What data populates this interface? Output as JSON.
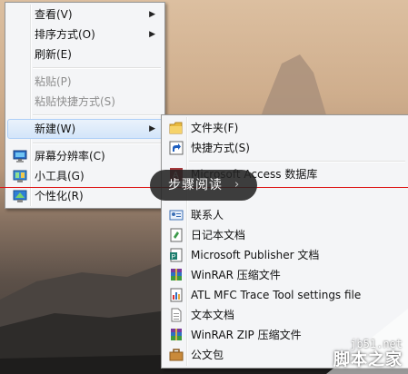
{
  "context_menu": {
    "items": [
      {
        "label": "查看(V)",
        "has_submenu": true
      },
      {
        "label": "排序方式(O)",
        "has_submenu": true
      },
      {
        "label": "刷新(E)"
      },
      {
        "label": "粘贴(P)",
        "disabled": true
      },
      {
        "label": "粘贴快捷方式(S)",
        "disabled": true
      },
      {
        "label": "新建(W)",
        "has_submenu": true,
        "highlighted": true
      },
      {
        "label": "屏幕分辨率(C)",
        "icon": "screen-resolution-icon"
      },
      {
        "label": "小工具(G)",
        "icon": "gadgets-icon"
      },
      {
        "label": "个性化(R)",
        "icon": "personalize-icon"
      }
    ]
  },
  "new_submenu": {
    "items": [
      {
        "label": "文件夹(F)",
        "icon": "folder-icon"
      },
      {
        "label": "快捷方式(S)",
        "icon": "shortcut-icon"
      },
      {
        "label": "Microsoft Access 数据库",
        "icon": "access-db-icon"
      },
      {
        "label": "联系人",
        "icon": "contact-icon"
      },
      {
        "label": "日记本文档",
        "icon": "journal-icon"
      },
      {
        "label": "Microsoft Publisher 文档",
        "icon": "publisher-icon"
      },
      {
        "label": "WinRAR 压缩文件",
        "icon": "winrar-icon"
      },
      {
        "label": "ATL MFC Trace Tool settings file",
        "icon": "atl-trace-icon"
      },
      {
        "label": "文本文档",
        "icon": "text-document-icon"
      },
      {
        "label": "WinRAR ZIP 压缩文件",
        "icon": "winrar-zip-icon"
      },
      {
        "label": "公文包",
        "icon": "briefcase-icon"
      }
    ]
  },
  "overlay": {
    "label": "步骤阅读",
    "arrow": "›"
  },
  "watermark": {
    "url": "jb51.net",
    "name": "脚本之家"
  },
  "colors": {
    "menu_bg": "#f4f5f7",
    "highlight": "#d3e5fa",
    "overlay_bg": "#232323",
    "red_line": "#dd1111"
  }
}
